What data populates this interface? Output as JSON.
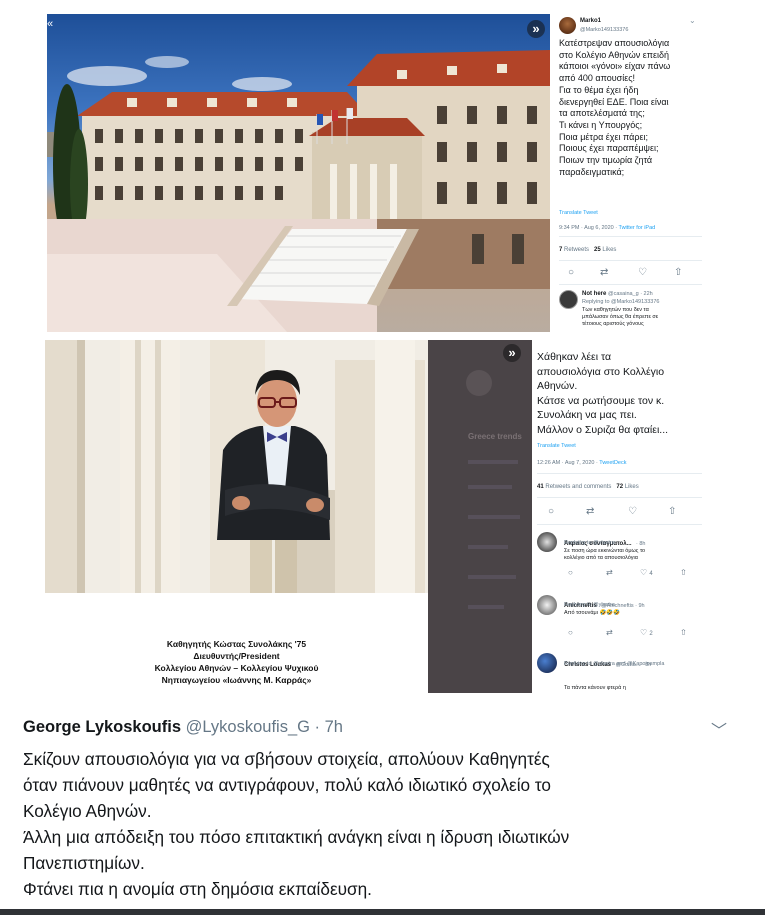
{
  "top_photo": {
    "expand_label": "»",
    "scroll_hint": "«"
  },
  "tweet1": {
    "name": "Marko1",
    "handle": "@Marko149133376",
    "body_lines": [
      "Κατέστρεψαν απουσιολόγια",
      "στο Κολέγιο Αθηνών επειδή",
      "κάποιοι «γόνοι» είχαν πάνω",
      "από 400 απουσίες!",
      "Για το θέμα έχει ήδη",
      "διενεργηθεί ΕΔΕ. Ποια είναι",
      "τα αποτελέσματά της;",
      "Τι κάνει η Υπουργός;",
      "Ποια μέτρα έχει πάρει;",
      "Ποιους έχει παραπέμψει;",
      "Ποιων την τιμωρία ζητά",
      "παραδειγματικά;"
    ],
    "translate": "Translate Tweet",
    "timestamp": "9:34 PM · Aug 6, 2020 · ",
    "source": "Twitter for iPad",
    "retweets": "7",
    "retweets_label": "Retweets",
    "likes": "25",
    "likes_label": "Likes",
    "reply": {
      "name": "Not here",
      "handle": "@casaina_g · 22h",
      "replying": "Replying to @Marko149133376",
      "text1": "Των καθηγητών που δεν τα",
      "text2": "μπάλωσαν όπως θα έπρεπε σε",
      "text3": "τέτοιους αριστούς γόνους"
    }
  },
  "photo2": {
    "caption_lines": [
      "Καθηγητής Κώστας Συνολάκης '75",
      "Διευθυντής/President",
      "Κολλεγίου Αθηνών – Κολλεγίου Ψυχικού",
      "Νηπιαγωγείου «Ιωάννης Μ. Καρράς»"
    ],
    "expand_label": "»",
    "overlay_heading": "Greece trends"
  },
  "tweet2": {
    "body_lines": [
      "Χάθηκαν λέει τα",
      "απουσιολόγια στο Κολλέγιο",
      "Αθηνών.",
      "Κάτσε να ρωτήσουμε τον κ.",
      "Συνολάκη να μας πει.",
      "Μάλλον ο Συριζα θα φταίει..."
    ],
    "translate": "Translate Tweet",
    "timestamp": "12:26 AM · Aug 7, 2020 · ",
    "source": "TweetDeck",
    "retweets": "41",
    "retweets_label": "Retweets and comments",
    "likes": "72",
    "likes_label": "Likes",
    "replies": [
      {
        "name": "Ακραίος συνταγματολ...",
        "time": "· 8h",
        "replying": "Replying to @ylastra",
        "text1": "Σε ποση ώρα εκκινώνται όμως το",
        "text2": "κολλέγιο από τα απουσιολόγια",
        "likes": "4"
      },
      {
        "name": "Anichneftis",
        "time": "@Anichneftis · 9h",
        "replying": "Replying to @ylastra",
        "text1": "Από τσουνάμι 🤣🤣🤣",
        "text2": "",
        "likes": "2"
      },
      {
        "name": "Christos Loukas",
        "time": "@Corfia... · 8h",
        "replying": "Replying to @ylastra and @Kapoiosmpla",
        "text1": "Τα πάντα κάνουν φτερά η",
        "text2": "",
        "likes": ""
      }
    ]
  },
  "main_tweet": {
    "author": "George Lykoskoufis",
    "handle": "@Lykoskoufis_G · 7h",
    "lines": [
      "Σκίζουν απουσιολόγια για να σβήσουν στοιχεία, απολύουν Καθηγητές",
      "όταν πιάνουν μαθητές να αντιγράφουν, πολύ καλό ιδιωτικό σχολείο το",
      "Κολέγιο Αθηνών.",
      "Άλλη μια απόδειξη του πόσο επιτακτική ανάγκη είναι η ίδρυση ιδιωτικών",
      "Πανεπιστημίων.",
      "Φτάνει πια η ανομία στη δημόσια εκπαίδευση."
    ]
  }
}
